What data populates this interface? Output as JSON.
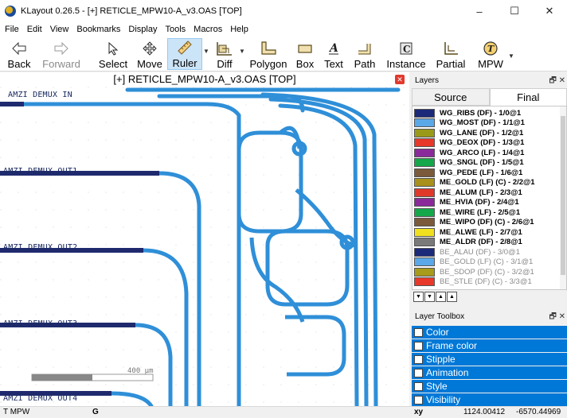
{
  "window": {
    "title": "KLayout 0.26.5 - [+] RETICLE_MPW10-A_v3.OAS [TOP]",
    "minimize": "–",
    "maximize": "☐",
    "close": "✕"
  },
  "menu": [
    "File",
    "Edit",
    "View",
    "Bookmarks",
    "Display",
    "Tools",
    "Macros",
    "Help"
  ],
  "toolbar": {
    "back": "Back",
    "forward": "Forward",
    "select": "Select",
    "move": "Move",
    "ruler": "Ruler",
    "diff": "Diff",
    "polygon": "Polygon",
    "box": "Box",
    "text": "Text",
    "path": "Path",
    "instance": "Instance",
    "partial": "Partial",
    "mpw": "MPW"
  },
  "canvas": {
    "title": "[+] RETICLE_MPW10-A_v3.OAS [TOP]",
    "labels": [
      "AMZI DEMUX IN",
      "AMZI DEMUX OUT1",
      "AMZI DEMUX OUT2",
      "AMZI DEMUX OUT3",
      "AMZI DEMUX OUT4"
    ],
    "scale": "400 µm",
    "waveguide_color": "#2f8fd8",
    "stub_color": "#1f2a6e"
  },
  "layers_panel": {
    "title": "Layers",
    "tabs": [
      "Source",
      "Final"
    ],
    "active_tab": "Final",
    "items": [
      {
        "name": "WG_RIBS (DF) - 1/0@1",
        "color": "#1c2a7a",
        "dim": false
      },
      {
        "name": "WG_MOST (DF) - 1/1@1",
        "color": "#5aa8e8",
        "dim": false
      },
      {
        "name": "WG_LANE (DF) - 1/2@1",
        "color": "#9a9a1a",
        "dim": false
      },
      {
        "name": "WG_DEOX (DF) - 1/3@1",
        "color": "#e8382a",
        "dim": false
      },
      {
        "name": "WG_ARCO (LF) - 1/4@1",
        "color": "#8a2a9a",
        "dim": false
      },
      {
        "name": "WG_SNGL (DF) - 1/5@1",
        "color": "#14a84a",
        "dim": false
      },
      {
        "name": "WG_PEDE (LF) - 1/6@1",
        "color": "#7a5a3a",
        "dim": false
      },
      {
        "name": "ME_GOLD (LF) (C) - 2/2@1",
        "color": "#a8901a",
        "dim": false
      },
      {
        "name": "ME_ALUM (LF) - 2/3@1",
        "color": "#e0382a",
        "dim": false
      },
      {
        "name": "ME_HVIA (DF) - 2/4@1",
        "color": "#8a2a9a",
        "dim": false
      },
      {
        "name": "ME_WIRE (LF) - 2/5@1",
        "color": "#14a84a",
        "dim": false
      },
      {
        "name": "ME_WIPO (DF) (C) - 2/6@1",
        "color": "#7a5a3a",
        "dim": false
      },
      {
        "name": "ME_ALWE (LF) - 2/7@1",
        "color": "#f0e020",
        "dim": false
      },
      {
        "name": "ME_ALDR (DF) - 2/8@1",
        "color": "#7a7a7a",
        "dim": false
      },
      {
        "name": "BE_ALAU (DF) - 3/0@1",
        "color": "#1c2a7a",
        "dim": true
      },
      {
        "name": "BE_GOLD (LF) (C) - 3/1@1",
        "color": "#5aa8e8",
        "dim": true
      },
      {
        "name": "BE_SDOP (DF) (C) - 3/2@1",
        "color": "#a89a1a",
        "dim": true
      },
      {
        "name": "BE_STLE (DF) (C) - 3/3@1",
        "color": "#e8382a",
        "dim": true
      }
    ]
  },
  "toolbox": {
    "title": "Layer Toolbox",
    "items": [
      "Color",
      "Frame color",
      "Stipple",
      "Animation",
      "Style",
      "Visibility"
    ]
  },
  "status": {
    "mode": "T MPW",
    "grid": "G",
    "coord_label": "xy",
    "x": "1124.00412",
    "y": "-6570.44969"
  }
}
